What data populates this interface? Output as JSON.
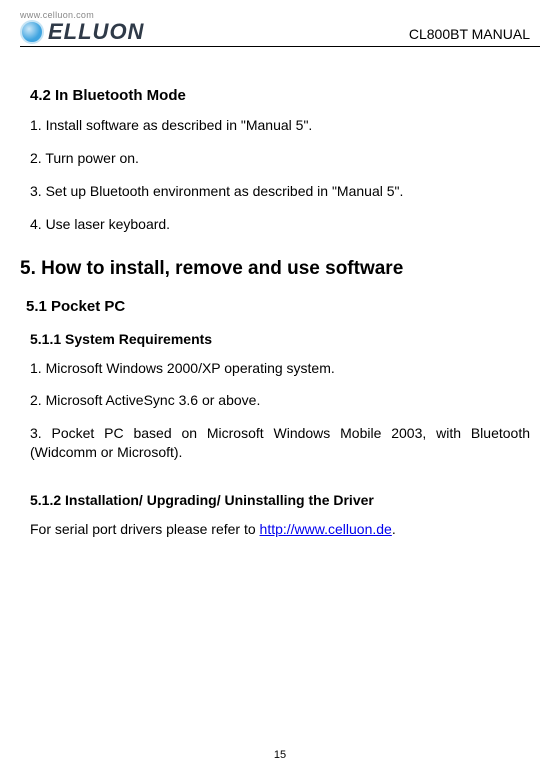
{
  "header": {
    "logo_url": "www.celluon.com",
    "logo_text": "ELLUON",
    "manual_title": "CL800BT MANUAL"
  },
  "section_4_2": {
    "heading": "4.2 In Bluetooth Mode",
    "items": [
      "1. Install software as described in \"Manual 5\".",
      "2. Turn power on.",
      "3. Set up Bluetooth environment as described in \"Manual 5\".",
      "4. Use laser keyboard."
    ]
  },
  "section_5": {
    "heading": "5. How to install, remove and use software"
  },
  "section_5_1": {
    "heading": "5.1 Pocket PC"
  },
  "section_5_1_1": {
    "heading": "5.1.1 System Requirements",
    "items": [
      "1. Microsoft Windows 2000/XP operating system.",
      "2. Microsoft ActiveSync 3.6 or above.",
      "3. Pocket PC based on Microsoft Windows Mobile 2003, with Bluetooth (Widcomm or Microsoft)."
    ]
  },
  "section_5_1_2": {
    "heading": "5.1.2    Installation/ Upgrading/ Uninstalling the Driver",
    "text_before_link": "For serial port drivers please refer to ",
    "link_text": "http://www.celluon.de",
    "link_href": "http://www.celluon.de",
    "text_after_link": "."
  },
  "page_number": "15"
}
